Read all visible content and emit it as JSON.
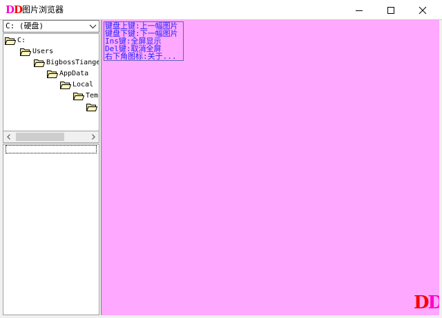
{
  "window": {
    "logo_d1": "D",
    "logo_d2": "D",
    "title": "图片浏览器",
    "minimize_icon": "minimize-icon",
    "maximize_icon": "maximize-icon",
    "close_icon": "close-icon"
  },
  "drive_selector": {
    "value": "C: (硬盘)"
  },
  "tree": {
    "nodes": [
      {
        "label": "C:"
      },
      {
        "label": "Users"
      },
      {
        "label": "BigbossTiange"
      },
      {
        "label": "AppData"
      },
      {
        "label": "Local"
      },
      {
        "label": "Tem"
      },
      {
        "label": ""
      }
    ]
  },
  "viewer": {
    "help_lines": [
      "键盘上键:上一幅图片",
      "键盘下键:下一幅图片",
      "Ins键:全屏显示",
      "Del键:取消全屏",
      "右下角图标:关于..."
    ],
    "corner_logo_d1": "D",
    "corner_logo_d2": "D",
    "background_color": "#ffa8ff"
  }
}
